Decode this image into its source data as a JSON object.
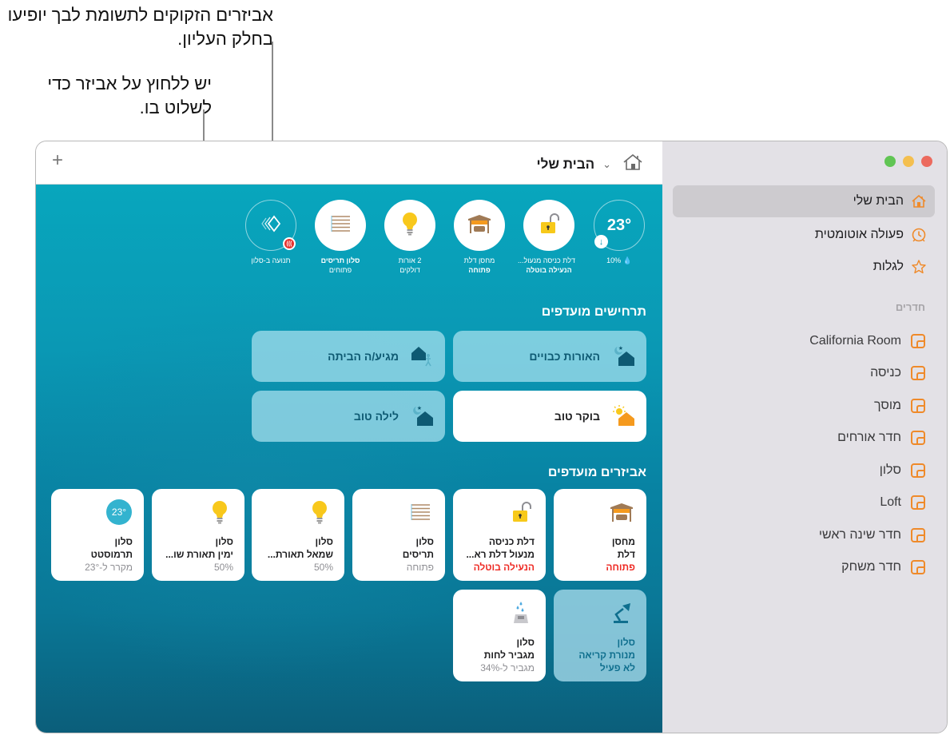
{
  "callouts": {
    "top_accessories": "אביזרים הזקוקים לתשומת לבך יופיעו בחלק העליון.",
    "tap_accessory": "יש ללחוץ על אביזר כדי לשלוט בו."
  },
  "window": {
    "traffic_lights": {
      "close": "#ec6a5e",
      "minimize": "#f4bf4f",
      "zoom": "#61c554"
    }
  },
  "toolbar": {
    "add_label": "+",
    "home_name": "הבית שלי",
    "home_icon": "house-icon",
    "chevron_icon": "chevron-down-icon"
  },
  "sidebar": {
    "nav": [
      {
        "label": "הבית שלי",
        "icon": "house-icon",
        "active": true
      },
      {
        "label": "פעולה אוטומטית",
        "icon": "clock-icon",
        "active": false
      },
      {
        "label": "לגלות",
        "icon": "star-icon",
        "active": false
      }
    ],
    "rooms_header": "חדרים",
    "rooms": [
      "California Room",
      "כניסה",
      "מוסך",
      "חדר אורחים",
      "סלון",
      "Loft",
      "חדר שינה ראשי",
      "חדר משחק"
    ],
    "accent_color": "#ef8a2a"
  },
  "status_row": [
    {
      "id": "climate",
      "value": "23°",
      "line1": "10%",
      "line2": "",
      "icon": "droplet-icon"
    },
    {
      "id": "lock",
      "line1": "דלת כניסה מנעול...",
      "line2": "הנעילה בוטלה",
      "icon": "unlocked-padlock-icon"
    },
    {
      "id": "garage",
      "line1": "מחסן דלת",
      "line2": "פתוחה",
      "icon": "garage-door-icon"
    },
    {
      "id": "lights",
      "line1": "2 אורות",
      "line2": "דולקים",
      "icon": "lightbulb-icon"
    },
    {
      "id": "blinds",
      "line1": "סלון תריסים",
      "line2": "פתוחים",
      "icon": "blinds-icon"
    },
    {
      "id": "motion",
      "line1": "תנועה ב-סלון",
      "line2": "",
      "icon": "motion-sensor-icon"
    }
  ],
  "scenes_title": "תרחישים מועדפים",
  "scenes": [
    {
      "label": "האורות כבויים",
      "icon": "night-house-icon",
      "on": false
    },
    {
      "label": "מגיע/ה הביתה",
      "icon": "arrive-home-icon",
      "on": false
    },
    {
      "label": "בוקר טוב",
      "icon": "sunrise-house-icon",
      "on": true
    },
    {
      "label": "לילה טוב",
      "icon": "night-house-icon",
      "on": false
    }
  ],
  "accessories_title": "אביזרים מועדפים",
  "accessories": [
    {
      "room": "מחסן",
      "name": "דלת",
      "status": "פתוחה",
      "status_alert": true,
      "icon": "garage-door-icon",
      "on": true
    },
    {
      "room": "דלת כניסה",
      "name": "מנעול דלת רא...",
      "status": "הנעילה בוטלה",
      "status_alert": true,
      "icon": "unlocked-padlock-icon",
      "on": true
    },
    {
      "room": "סלון",
      "name": "תריסים",
      "status": "פתוחה",
      "status_alert": false,
      "icon": "blinds-icon",
      "on": true
    },
    {
      "room": "סלון",
      "name": "שמאל תאורת...",
      "status": "50%",
      "status_alert": false,
      "icon": "lightbulb-icon",
      "on": true
    },
    {
      "room": "סלון",
      "name": "ימין תאורת שו...",
      "status": "50%",
      "status_alert": false,
      "icon": "lightbulb-icon",
      "on": true
    },
    {
      "room": "סלון",
      "name": "תרמוסטט",
      "status": "מקרר ל-23°",
      "status_alert": false,
      "icon": "thermostat-icon",
      "value": "23°",
      "on": true
    },
    {
      "room": "סלון",
      "name": "מנורת קריאה",
      "status": "לא פעיל",
      "status_alert": false,
      "icon": "desk-lamp-icon",
      "on": false
    },
    {
      "room": "סלון",
      "name": "מגביר לחות",
      "status": "מגביר ל-34%",
      "status_alert": false,
      "icon": "humidifier-icon",
      "on": true
    }
  ]
}
